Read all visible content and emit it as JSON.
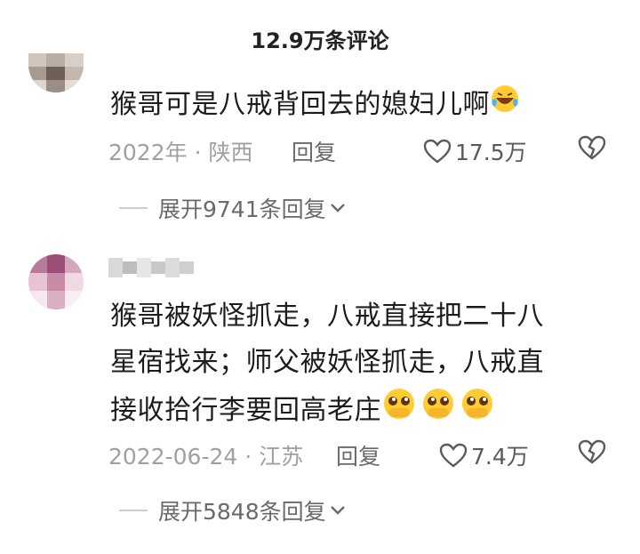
{
  "header": {
    "title": "12.9万条评论"
  },
  "comments": [
    {
      "text": "猴哥可是八戒背回去的媳妇儿啊",
      "emoji": "laughing-tears-emoji",
      "date": "2022年 · 陕西",
      "reply_label": "回复",
      "likes": "17.5万",
      "expand_label": "展开9741条回复"
    },
    {
      "text_lines": [
        "猴哥被妖怪抓走，八戒直接把二十八",
        "星宿找来；师父被妖怪抓走，八戒直",
        "接收拾行李要回高老庄"
      ],
      "emoji": "pleading-face-emoji",
      "date": "2022-06-24 · 江苏",
      "reply_label": "回复",
      "likes": "7.4万",
      "expand_label": "展开5848条回复"
    }
  ],
  "colors": {
    "meta_gray": "#a0a0a0",
    "text": "#1c1c1c"
  }
}
